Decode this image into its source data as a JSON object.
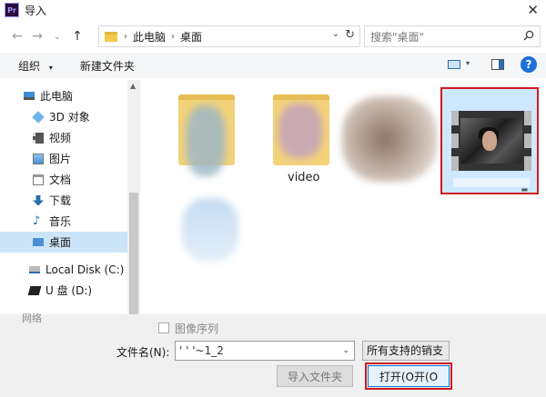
{
  "window": {
    "title": "导入",
    "app_badge": "Pr",
    "close_glyph": "✕"
  },
  "nav_buttons": {
    "back": "←",
    "forward": "→",
    "recent": "⌄",
    "up": "↑"
  },
  "address": {
    "crumbs": [
      "此电脑",
      "桌面"
    ],
    "separator": "›",
    "dropdown": "⌄",
    "refresh": "↻"
  },
  "search": {
    "placeholder": "搜索\"桌面\""
  },
  "toolbar": {
    "organize": "组织",
    "organize_caret": "▾",
    "new_folder": "新建文件夹",
    "view_caret": "▾",
    "help": "?"
  },
  "navpane": {
    "items": [
      {
        "label": "此电脑",
        "icon": "computer-icon",
        "indent": 0,
        "selected": false
      },
      {
        "label": "3D 对象",
        "icon": "3d-objects-icon",
        "indent": 1,
        "selected": false
      },
      {
        "label": "视频",
        "icon": "videos-icon",
        "indent": 1,
        "selected": false
      },
      {
        "label": "图片",
        "icon": "pictures-icon",
        "indent": 1,
        "selected": false
      },
      {
        "label": "文档",
        "icon": "documents-icon",
        "indent": 1,
        "selected": false
      },
      {
        "label": "下载",
        "icon": "downloads-icon",
        "indent": 1,
        "selected": false
      },
      {
        "label": "音乐",
        "icon": "music-icon",
        "indent": 1,
        "selected": false
      },
      {
        "label": "桌面",
        "icon": "desktop-icon",
        "indent": 1,
        "selected": true
      },
      {
        "label": "Local Disk (C:)",
        "icon": "disk-icon",
        "indent": 1,
        "selected": false
      },
      {
        "label": "U 盘 (D:)",
        "icon": "usb-drive-icon",
        "indent": 1,
        "selected": false
      }
    ],
    "scroll_arrow": "▲"
  },
  "files": {
    "video_folder_label": "video",
    "selected_caption_mark": "▬"
  },
  "bottom": {
    "partial_label": "网络",
    "image_sequence_label": "图像序列",
    "filename_label": "文件名(N):",
    "filename_value": "' '   '~1_2",
    "filename_dropdown": "⌄",
    "filter_value": "所有支持的销支",
    "import_folder_button": "导入文件夹",
    "open_button": "打开(O开(O"
  }
}
